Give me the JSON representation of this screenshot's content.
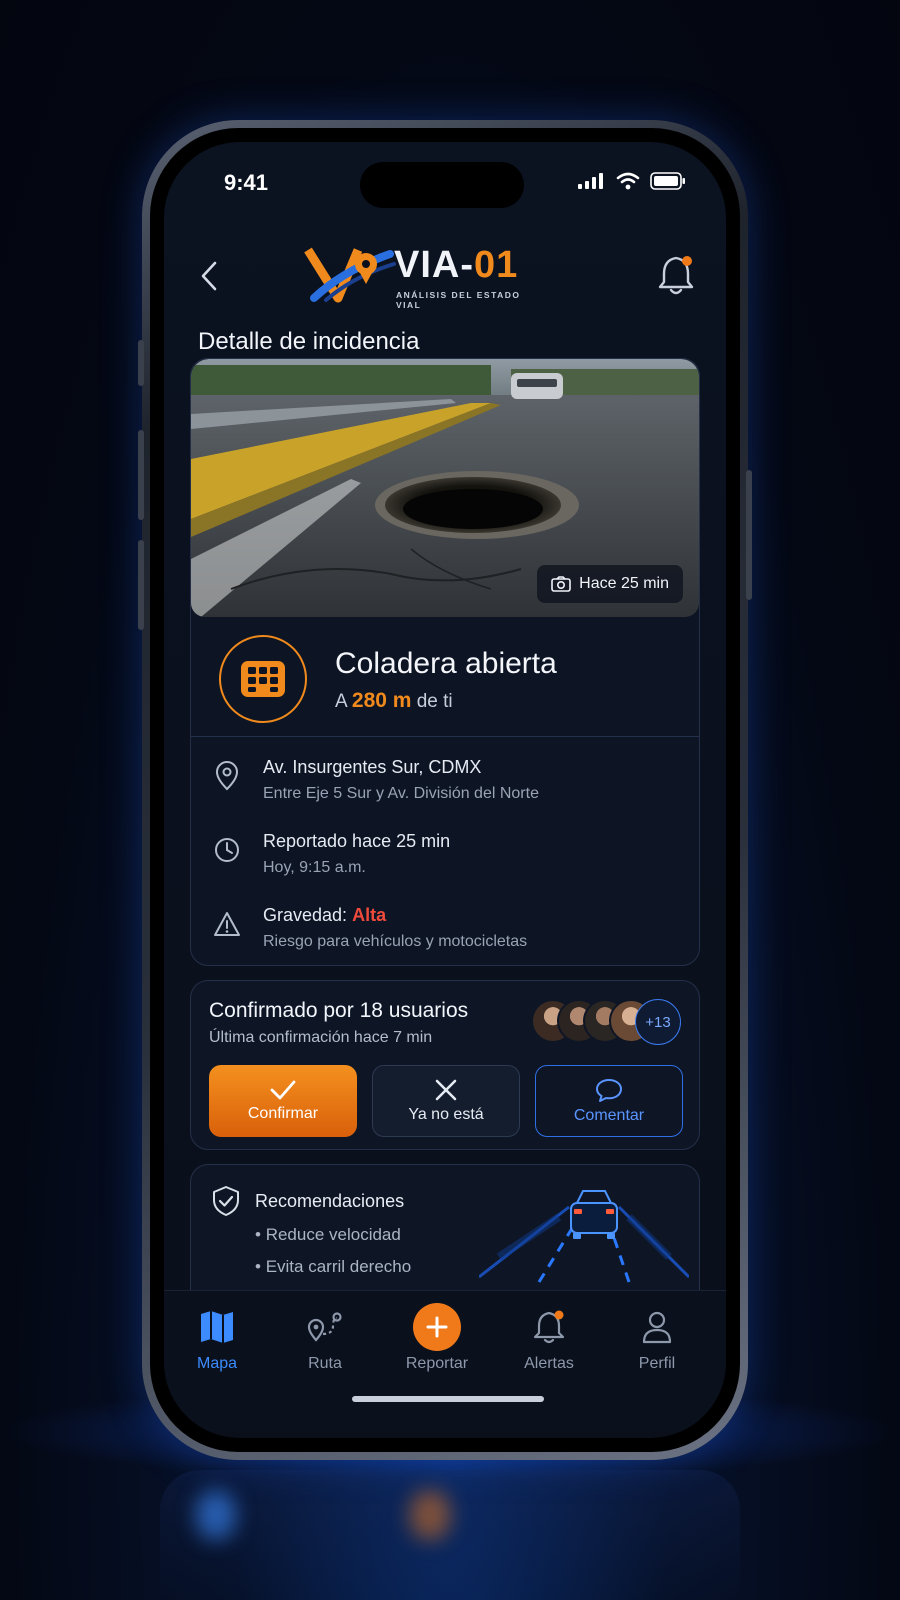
{
  "status_bar": {
    "time": "9:41"
  },
  "header": {
    "logo_main": "VIA-",
    "logo_accent": "01",
    "logo_subtitle": "ANÁLISIS DEL ESTADO VIAL",
    "has_notification": true
  },
  "page_title": "Detalle de incidencia",
  "photo": {
    "timestamp": "Hace 25 min"
  },
  "incident": {
    "title": "Coladera abierta",
    "distance_prefix": "A",
    "distance_value": "280 m",
    "distance_suffix": "de ti"
  },
  "details": {
    "location": {
      "main": "Av. Insurgentes Sur, CDMX",
      "sub": "Entre Eje 5 Sur y Av. División del Norte"
    },
    "reported": {
      "main": "Reportado hace 25 min",
      "sub": "Hoy, 9:15 a.m."
    },
    "severity": {
      "label": "Gravedad:",
      "value": "Alta",
      "sub": "Riesgo para vehículos y motocicletas",
      "color": "#ef4a3c"
    }
  },
  "confirmation": {
    "title": "Confirmado por 18 usuarios",
    "subtitle": "Última confirmación hace 7 min",
    "extra_count": "+13",
    "buttons": {
      "confirm": "Confirmar",
      "gone": "Ya no está",
      "comment": "Comentar"
    }
  },
  "recommendations": {
    "title": "Recomendaciones",
    "items": [
      "Reduce velocidad",
      "Evita carril derecho"
    ]
  },
  "tabbar": {
    "items": [
      {
        "label": "Mapa",
        "icon": "map-icon",
        "active": true
      },
      {
        "label": "Ruta",
        "icon": "route-icon",
        "active": false
      },
      {
        "label": "Reportar",
        "icon": "plus-icon",
        "active": false
      },
      {
        "label": "Alertas",
        "icon": "bell-icon",
        "active": false
      },
      {
        "label": "Perfil",
        "icon": "user-icon",
        "active": false
      }
    ]
  },
  "colors": {
    "accent": "#f08a1c",
    "active_tab": "#3c8cff",
    "severity_high": "#ef4a3c"
  }
}
